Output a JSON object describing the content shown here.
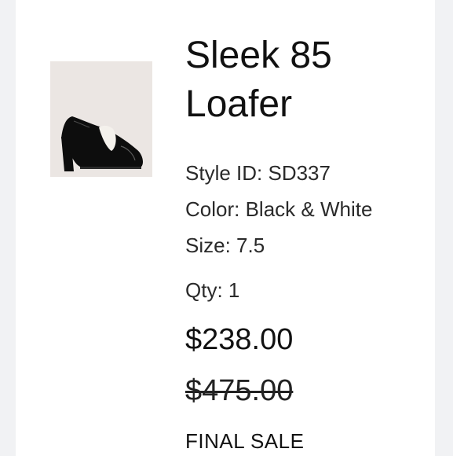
{
  "product": {
    "image_alt": "black and white patent loafer pump",
    "title_line1": "Sleek 85",
    "title_line2": "Loafer",
    "style_id": "Style ID: SD337",
    "color": "Color: Black & White",
    "size": "Size: 7.5",
    "qty": "Qty: 1",
    "price": "$238.00",
    "original_price": "$475.00",
    "sale_label": "FINAL SALE"
  },
  "colors": {
    "thumb_background": "#ebe6e3",
    "shoe": "#0d0d0d",
    "accent": "#f4f1ec"
  }
}
